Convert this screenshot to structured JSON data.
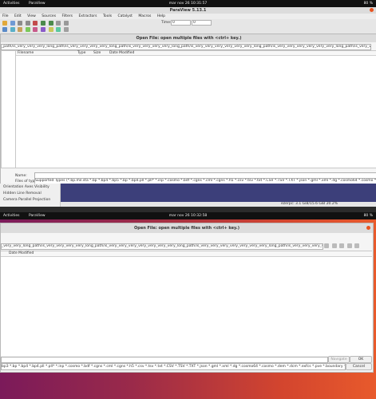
{
  "top": {
    "activities": "Activities",
    "app": "ParaView",
    "clock": "mar nov 26  10:31:57",
    "battery": "80 %",
    "window_title": "ParaView 5.13.1",
    "menu": [
      "File",
      "Edit",
      "View",
      "Sources",
      "Filters",
      "Extractors",
      "Tools",
      "Catalyst",
      "Macros",
      "Help"
    ],
    "time_label": "Time:",
    "time_value": "0",
    "time_step": "0",
    "dialog_title": "Open File:  open multiple files with <ctrl+ key.)",
    "path": "_path/is_very_very_very_long_path/is_very_very_very_very_long_path/is_very_very_very_very_long_path/is_very_very_very_very_very_very_long_path/is_very_very_very_very_very_very_long_path/is_very_very_very_very_very_very_very_very_very_very_very_very_very_very_very_very_very_very_very_very_very_very_very_very_very_very_very_v",
    "cols": [
      "Filename",
      "Type",
      "Size",
      "Date Modified"
    ],
    "name_label": "Name:",
    "filetype_label": "Files of type:",
    "filetype_value": "Supported Types (*.bp.mil.sta *.bp *.bp4 *.bp5 *.bp *.bp4.pll *.pll* *.inp *.cosmo *.bdf *.cgns *.cml *.cgns *.h5 *.csv *.tsv *.txt *.CSV *.TSV *.TXT *.json *.gml *.xml *.dg *.cosmo64 *.cosmo *.dem *.dcm *.exfcs *.pve *.boundary *.hierarchy *.n",
    "sidebar_items": [
      "Orientation Axes Visibility",
      "Hidden Line Removal",
      "Camera Parallel Projection"
    ],
    "status": "ezerpc: 3.1 GiB/15.6 GiB 20.2%"
  },
  "bottom": {
    "activities": "Activities",
    "app": "ParaView",
    "clock": "mar nov 26  10:32:58",
    "battery": "80 %",
    "dialog_title": "Open File:  open multiple files with <ctrl+ key.)",
    "path": "_very_very_long_path/is_very_very_very_very_long_path/is_very_very_very_very_very_very_very_long_path/is_very_very_very_very_very_very_very_long_path/is_very_very_very_very_very_very_long_path/",
    "col": "Date Modified",
    "navigate_btn": "Navigate",
    "ok_btn": "OK",
    "filetype_value": "bp3 *.bp *.bp4 *.bp4.pll *.pll* *.inp *.cosmo *.bdf *.cgns *.cml *.cgns *.h5 *.csv *.tsv *.txt *.CSV *.TSV *.TXT *.json *.gml *.xml *.dg *.cosmo64 *.cosmo *.dem *.dcm *.exfcs *.pve *.boundary *.hierarchy *.boundary *.hierarchy *.n",
    "cancel_btn": "Cancel"
  }
}
